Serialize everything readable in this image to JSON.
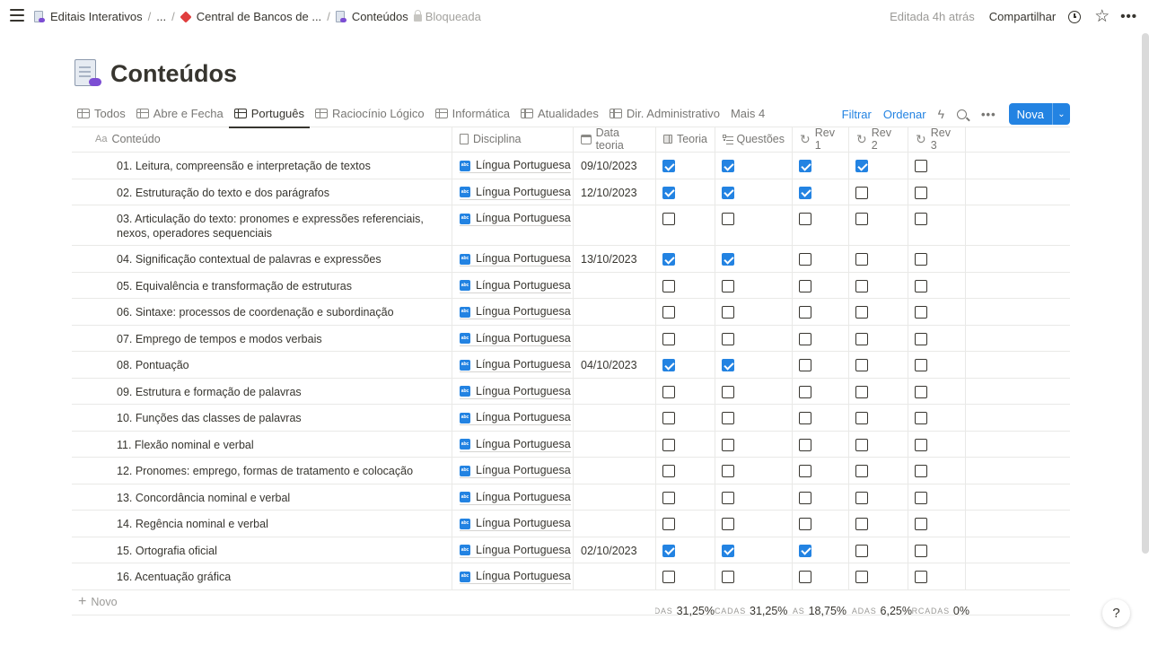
{
  "topbar": {
    "breadcrumbs": [
      "Editais Interativos",
      "...",
      "Central de Bancos de ...",
      "Conteúdos"
    ],
    "locked": "Bloqueada",
    "edited": "Editada 4h atrás",
    "share": "Compartilhar"
  },
  "page": {
    "title": "Conteúdos"
  },
  "views": {
    "tabs": [
      "Todos",
      "Abre e Fecha",
      "Português",
      "Raciocínio Lógico",
      "Informática",
      "Atualidades",
      "Dir. Administrativo"
    ],
    "active": "Português",
    "more": "Mais 4",
    "filter": "Filtrar",
    "sort": "Ordenar",
    "new_button": "Nova"
  },
  "table": {
    "columns": [
      "Conteúdo",
      "Disciplina",
      "Data teoria",
      "Teoria",
      "Questões",
      "Rev 1",
      "Rev 2",
      "Rev 3"
    ],
    "rows": [
      {
        "conteudo": "01. Leitura, compreensão e interpretação de textos",
        "disciplina": "Língua Portuguesa",
        "data": "09/10/2023",
        "teoria": true,
        "questoes": true,
        "rev1": true,
        "rev2": true,
        "rev3": false
      },
      {
        "conteudo": "02. Estruturação do texto e dos parágrafos",
        "disciplina": "Língua Portuguesa",
        "data": "12/10/2023",
        "teoria": true,
        "questoes": true,
        "rev1": true,
        "rev2": false,
        "rev3": false
      },
      {
        "conteudo": "03. Articulação do texto: pronomes e expressões referenciais, nexos, operadores sequenciais",
        "disciplina": "Língua Portuguesa",
        "data": "",
        "teoria": false,
        "questoes": false,
        "rev1": false,
        "rev2": false,
        "rev3": false
      },
      {
        "conteudo": "04. Significação contextual de palavras e expressões",
        "disciplina": "Língua Portuguesa",
        "data": "13/10/2023",
        "teoria": true,
        "questoes": true,
        "rev1": false,
        "rev2": false,
        "rev3": false
      },
      {
        "conteudo": "05. Equivalência e transformação de estruturas",
        "disciplina": "Língua Portuguesa",
        "data": "",
        "teoria": false,
        "questoes": false,
        "rev1": false,
        "rev2": false,
        "rev3": false
      },
      {
        "conteudo": "06. Sintaxe: processos de coordenação e subordinação",
        "disciplina": "Língua Portuguesa",
        "data": "",
        "teoria": false,
        "questoes": false,
        "rev1": false,
        "rev2": false,
        "rev3": false
      },
      {
        "conteudo": "07. Emprego de tempos e modos verbais",
        "disciplina": "Língua Portuguesa",
        "data": "",
        "teoria": false,
        "questoes": false,
        "rev1": false,
        "rev2": false,
        "rev3": false
      },
      {
        "conteudo": "08. Pontuação",
        "disciplina": "Língua Portuguesa",
        "data": "04/10/2023",
        "teoria": true,
        "questoes": true,
        "rev1": false,
        "rev2": false,
        "rev3": false
      },
      {
        "conteudo": "09. Estrutura e formação de palavras",
        "disciplina": "Língua Portuguesa",
        "data": "",
        "teoria": false,
        "questoes": false,
        "rev1": false,
        "rev2": false,
        "rev3": false
      },
      {
        "conteudo": "10. Funções das classes de palavras",
        "disciplina": "Língua Portuguesa",
        "data": "",
        "teoria": false,
        "questoes": false,
        "rev1": false,
        "rev2": false,
        "rev3": false
      },
      {
        "conteudo": "11. Flexão nominal e verbal",
        "disciplina": "Língua Portuguesa",
        "data": "",
        "teoria": false,
        "questoes": false,
        "rev1": false,
        "rev2": false,
        "rev3": false
      },
      {
        "conteudo": "12. Pronomes: emprego, formas de tratamento e colocação",
        "disciplina": "Língua Portuguesa",
        "data": "",
        "teoria": false,
        "questoes": false,
        "rev1": false,
        "rev2": false,
        "rev3": false
      },
      {
        "conteudo": "13. Concordância nominal e verbal",
        "disciplina": "Língua Portuguesa",
        "data": "",
        "teoria": false,
        "questoes": false,
        "rev1": false,
        "rev2": false,
        "rev3": false
      },
      {
        "conteudo": "14. Regência nominal e verbal",
        "disciplina": "Língua Portuguesa",
        "data": "",
        "teoria": false,
        "questoes": false,
        "rev1": false,
        "rev2": false,
        "rev3": false
      },
      {
        "conteudo": "15. Ortografia oficial",
        "disciplina": "Língua Portuguesa",
        "data": "02/10/2023",
        "teoria": true,
        "questoes": true,
        "rev1": true,
        "rev2": false,
        "rev3": false
      },
      {
        "conteudo": "16. Acentuação gráfica",
        "disciplina": "Língua Portuguesa",
        "data": "",
        "teoria": false,
        "questoes": false,
        "rev1": false,
        "rev2": false,
        "rev3": false
      }
    ],
    "new_row": "Novo"
  },
  "calculations": [
    {
      "label": "DAS",
      "value": "31,25%"
    },
    {
      "label": "CADAS",
      "value": "31,25%"
    },
    {
      "label": "AS",
      "value": "18,75%"
    },
    {
      "label": "ADAS",
      "value": "6,25%"
    },
    {
      "label": "RCADAS",
      "value": "0%"
    }
  ],
  "help": "?",
  "colors": {
    "accent": "#2383e2",
    "text": "#37352f",
    "muted": "#787774"
  }
}
